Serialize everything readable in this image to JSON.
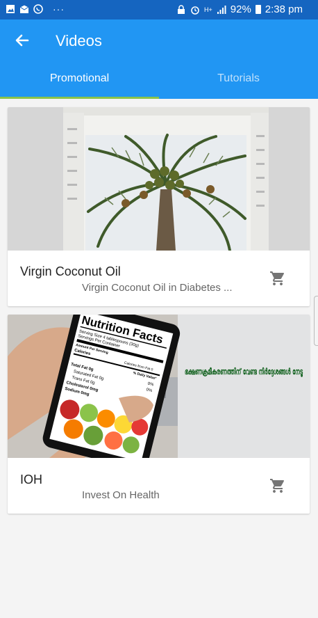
{
  "status_bar": {
    "battery": "92%",
    "time": "2:38 pm",
    "signal": "H+",
    "dots": "···"
  },
  "app_bar": {
    "title": "Videos",
    "tabs": [
      {
        "label": "Promotional",
        "selected": true
      },
      {
        "label": "Tutorials",
        "selected": false
      }
    ]
  },
  "videos": [
    {
      "title": "Virgin Coconut Oil",
      "subtitle": "Virgin Coconut Oil in Diabetes ...",
      "thumbnail": "coconut-oil-bottle-thumbnail"
    },
    {
      "title": "IOH",
      "subtitle": "Invest On Health",
      "thumbnail": "nutrition-facts-phone-thumbnail",
      "thumbnail_text": "ഭക്ഷണക്രമീകരണത്തിന് വേണ്ട നിർദ്ദേശങ്ങൾ നേടൂ",
      "label_title": "Nutrition Facts",
      "label_lines": [
        "Serving Size 4 tablespoons (30g)",
        "Servings Per Container",
        "Amount Per Serving",
        "Calories",
        "Calories from Fat 0",
        "% Daily Value*",
        "Total Fat 0g",
        "Saturated Fat 0g",
        "Trans Fat 0g",
        "Cholesterol 0mg",
        "Sodium 0mg",
        "0%",
        "0%",
        "0%",
        "0%"
      ]
    }
  ],
  "colors": {
    "status_bar": "#1565c0",
    "app_bar": "#2196f3",
    "tab_indicator": "#8bc34a",
    "text_green": "#0b5d18"
  }
}
